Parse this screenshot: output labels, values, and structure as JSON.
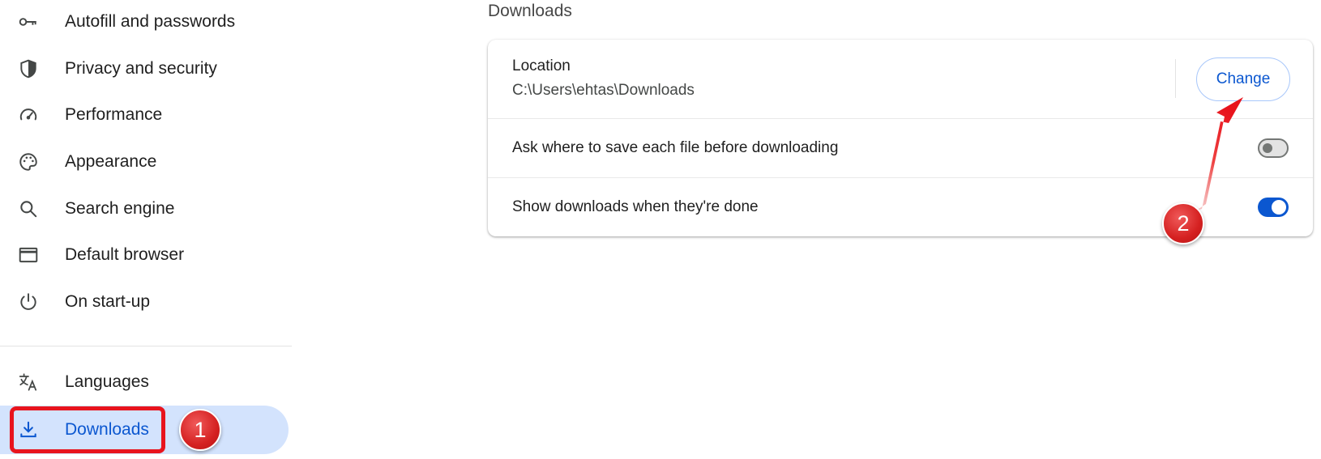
{
  "sidebar": {
    "items": [
      {
        "label": "Autofill and passwords",
        "icon": "key-icon"
      },
      {
        "label": "Privacy and security",
        "icon": "shield-icon"
      },
      {
        "label": "Performance",
        "icon": "speedometer-icon"
      },
      {
        "label": "Appearance",
        "icon": "palette-icon"
      },
      {
        "label": "Search engine",
        "icon": "search-icon"
      },
      {
        "label": "Default browser",
        "icon": "browser-window-icon"
      },
      {
        "label": "On start-up",
        "icon": "power-icon"
      },
      {
        "label": "Languages",
        "icon": "translate-icon"
      },
      {
        "label": "Downloads",
        "icon": "download-icon",
        "active": true
      }
    ]
  },
  "main": {
    "section_title": "Downloads",
    "location": {
      "label": "Location",
      "path": "C:\\Users\\ehtas\\Downloads",
      "change_label": "Change"
    },
    "settings": [
      {
        "label": "Ask where to save each file before downloading",
        "enabled": false
      },
      {
        "label": "Show downloads when they're done",
        "enabled": true
      }
    ]
  },
  "annotations": {
    "badge_1": "1",
    "badge_2": "2",
    "color": "#e8141d"
  },
  "colors": {
    "accent": "#0b57d0",
    "active_bg": "#d3e3fd"
  }
}
